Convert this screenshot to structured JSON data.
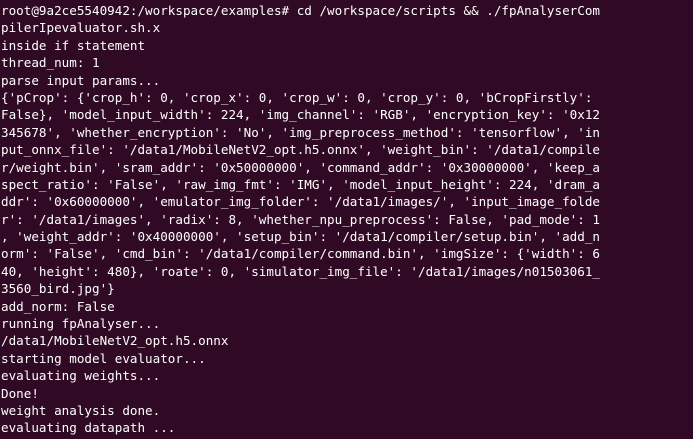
{
  "terminal": {
    "background": "#300a24",
    "foreground": "#ffffff",
    "lines": [
      "root@9a2ce5540942:/workspace/examples# cd /workspace/scripts && ./fpAnalyserCom",
      "pilerIpevaluator.sh.x",
      "inside if statement",
      "thread_num: 1",
      "parse input params...",
      "{'pCrop': {'crop_h': 0, 'crop_x': 0, 'crop_w': 0, 'crop_y': 0, 'bCropFirstly':",
      "False}, 'model_input_width': 224, 'img_channel': 'RGB', 'encryption_key': '0x12",
      "345678', 'whether_encryption': 'No', 'img_preprocess_method': 'tensorflow', 'in",
      "put_onnx_file': '/data1/MobileNetV2_opt.h5.onnx', 'weight_bin': '/data1/compile",
      "r/weight.bin', 'sram_addr': '0x50000000', 'command_addr': '0x30000000', 'keep_a",
      "spect_ratio': 'False', 'raw_img_fmt': 'IMG', 'model_input_height': 224, 'dram_a",
      "ddr': '0x60000000', 'emulator_img_folder': '/data1/images/', 'input_image_folde",
      "r': '/data1/images', 'radix': 8, 'whether_npu_preprocess': False, 'pad_mode': 1",
      ", 'weight_addr': '0x40000000', 'setup_bin': '/data1/compiler/setup.bin', 'add_n",
      "orm': 'False', 'cmd_bin': '/data1/compiler/command.bin', 'imgSize': {'width': 6",
      "40, 'height': 480}, 'roate': 0, 'simulator_img_file': '/data1/images/n01503061_",
      "3560_bird.jpg'}",
      "add_norm: False",
      "running fpAnalyser...",
      "/data1/MobileNetV2_opt.h5.onnx",
      "starting model evaluator...",
      "evaluating weights...",
      "Done!",
      "weight analysis done.",
      "evaluating datapath ..."
    ]
  }
}
